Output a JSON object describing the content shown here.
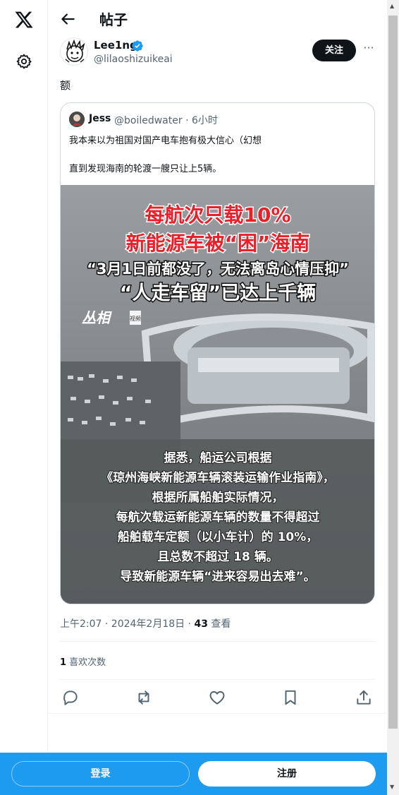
{
  "header": {
    "title": "帖子"
  },
  "post": {
    "author_name": "Lee1ng",
    "author_handle": "@lilaoshizuikeai",
    "follow_label": "关注",
    "more_label": "···",
    "text": "额",
    "timestamp": "上午2:07 · 2024年2月18日 · ",
    "views_count": "43",
    "views_label": " 查看",
    "likes_count": "1",
    "likes_label": " 喜欢次数"
  },
  "quote": {
    "author_name": "Jess",
    "author_handle": "@boiledwater",
    "time_ago": "6小时",
    "text_line1": "我本来以为祖国对国产电车抱有极大信心（幻想",
    "text_line2": "直到发现海南的轮渡一艘只让上5辆。",
    "media": {
      "headline": [
        "每航次只载10%",
        "新能源车被“困”海南",
        "“3月1日前都没了，无法离岛心情压抑”",
        "“人走车留”已达上千辆"
      ],
      "watermark": "丛相",
      "watermark_sub": "视频",
      "caption": [
        "据悉，船运公司根据",
        "《琼州海峡新能源车辆滚装运输作业指南》，",
        "根据所属船舶实际情况，",
        "每航次载运新能源车辆的数量不得超过",
        "船舶载车定额（以小车计）的 10%，",
        "且总数不超过 18 辆。",
        "导致新能源车辆“进来容易出去难”。"
      ]
    }
  },
  "bottom_bar": {
    "login_label": "登录",
    "signup_label": "注册"
  },
  "colors": {
    "brand": "#1d9bf0",
    "text": "#0f1419",
    "secondary": "#536471",
    "headline_red": "#e8202a"
  }
}
